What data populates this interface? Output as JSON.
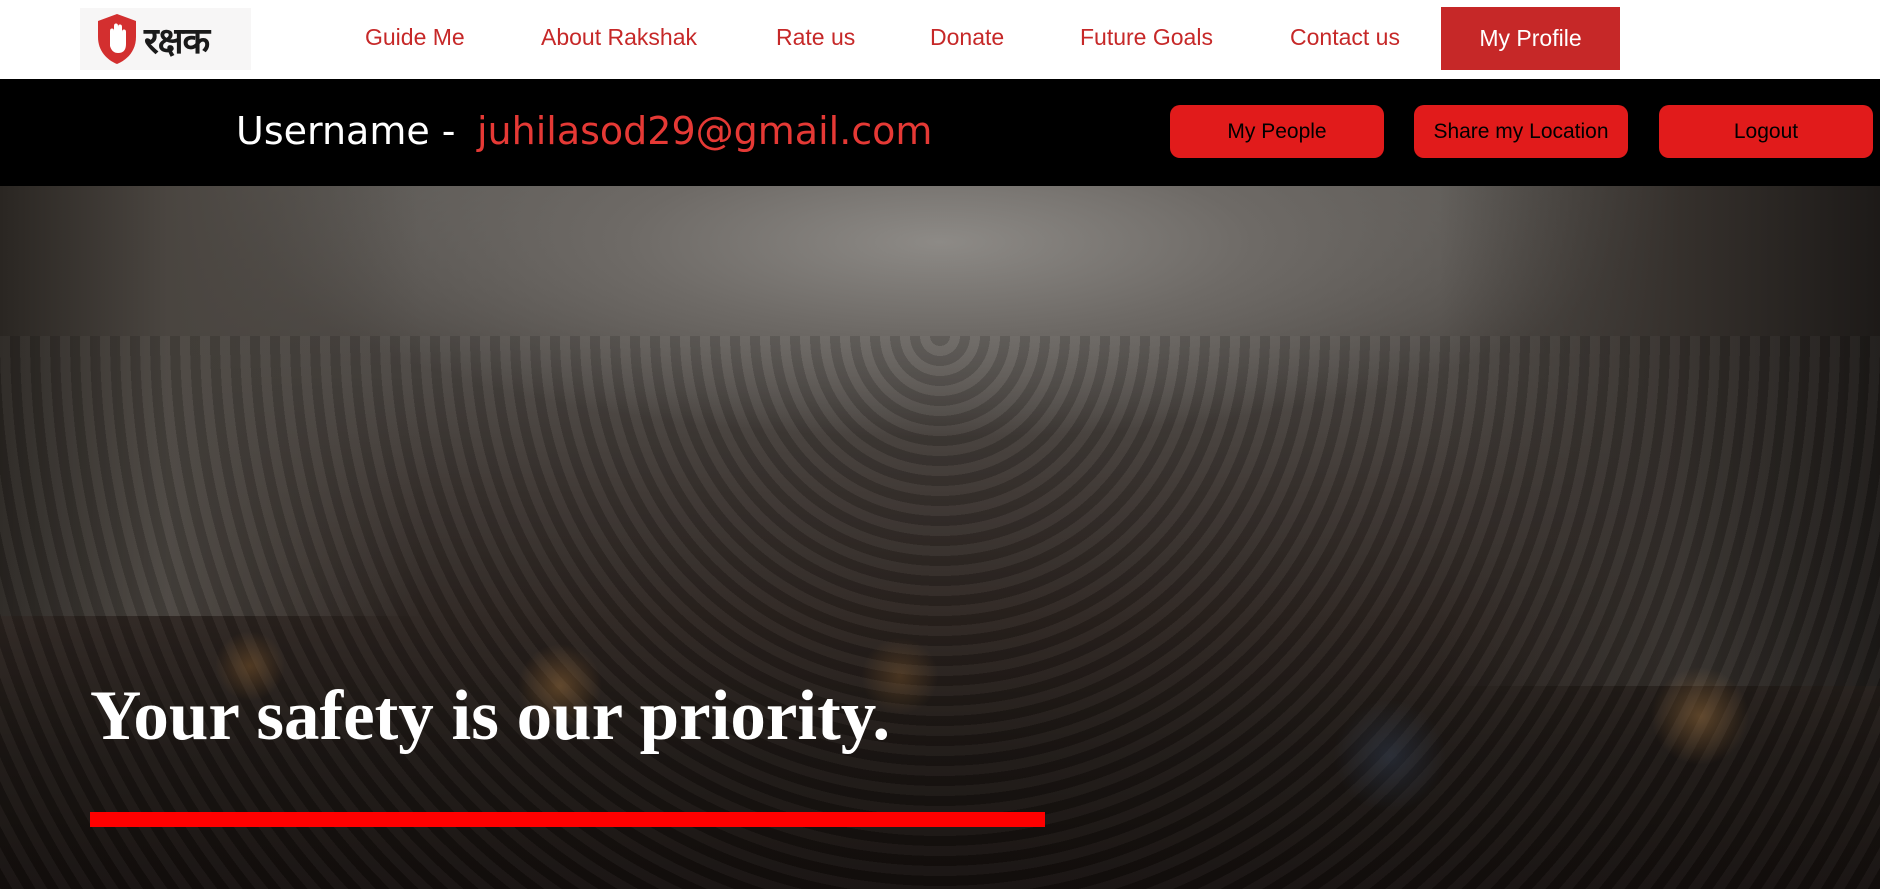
{
  "brand": {
    "logo_text": "रक्षक",
    "accent": "#c62828",
    "button_red": "#e11b1b",
    "underline_red": "#ff0000"
  },
  "nav": {
    "items": [
      {
        "label": "Guide Me"
      },
      {
        "label": "About Rakshak"
      },
      {
        "label": "Rate us"
      },
      {
        "label": "Donate"
      },
      {
        "label": "Future Goals"
      },
      {
        "label": "Contact us"
      }
    ],
    "profile_label": "My Profile"
  },
  "user": {
    "label": "Username -",
    "value": "juhilasod29@gmail.com"
  },
  "actions": {
    "my_people": "My People",
    "share_location": "Share my Location",
    "logout": "Logout"
  },
  "hero": {
    "title": "Your safety is our priority."
  }
}
